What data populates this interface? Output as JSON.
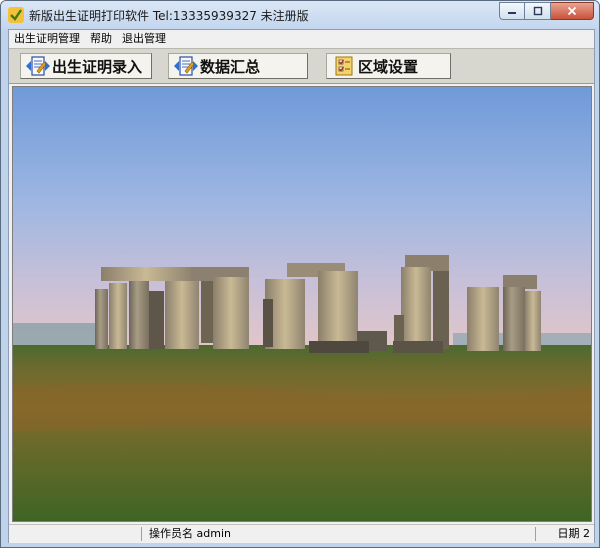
{
  "window": {
    "title": "新版出生证明打印软件  Tel:13335939327 未注册版",
    "icons": {
      "app": "app-icon",
      "minimize": "minimize-icon",
      "maximize": "maximize-icon",
      "close": "close-icon"
    }
  },
  "menu": {
    "items": [
      {
        "label": "出生证明管理"
      },
      {
        "label": "帮助"
      },
      {
        "label": "退出管理"
      }
    ]
  },
  "toolbar": {
    "buttons": [
      {
        "label": "出生证明录入",
        "icon": "notebook-edit-icon"
      },
      {
        "label": "数据汇总",
        "icon": "notebook-edit-icon"
      },
      {
        "label": "区域设置",
        "icon": "checklist-icon"
      }
    ]
  },
  "main": {
    "image_description": "Stonehenge landscape photo"
  },
  "status": {
    "operator_label": "操作员名",
    "operator_value": "admin",
    "date_label": "日期",
    "date_value": "2"
  },
  "colors": {
    "title_bar": "#c9dbf0",
    "toolbar": "#d8d7cf",
    "sky_top": "#7aa3db",
    "grass": "#4f6a2a"
  }
}
